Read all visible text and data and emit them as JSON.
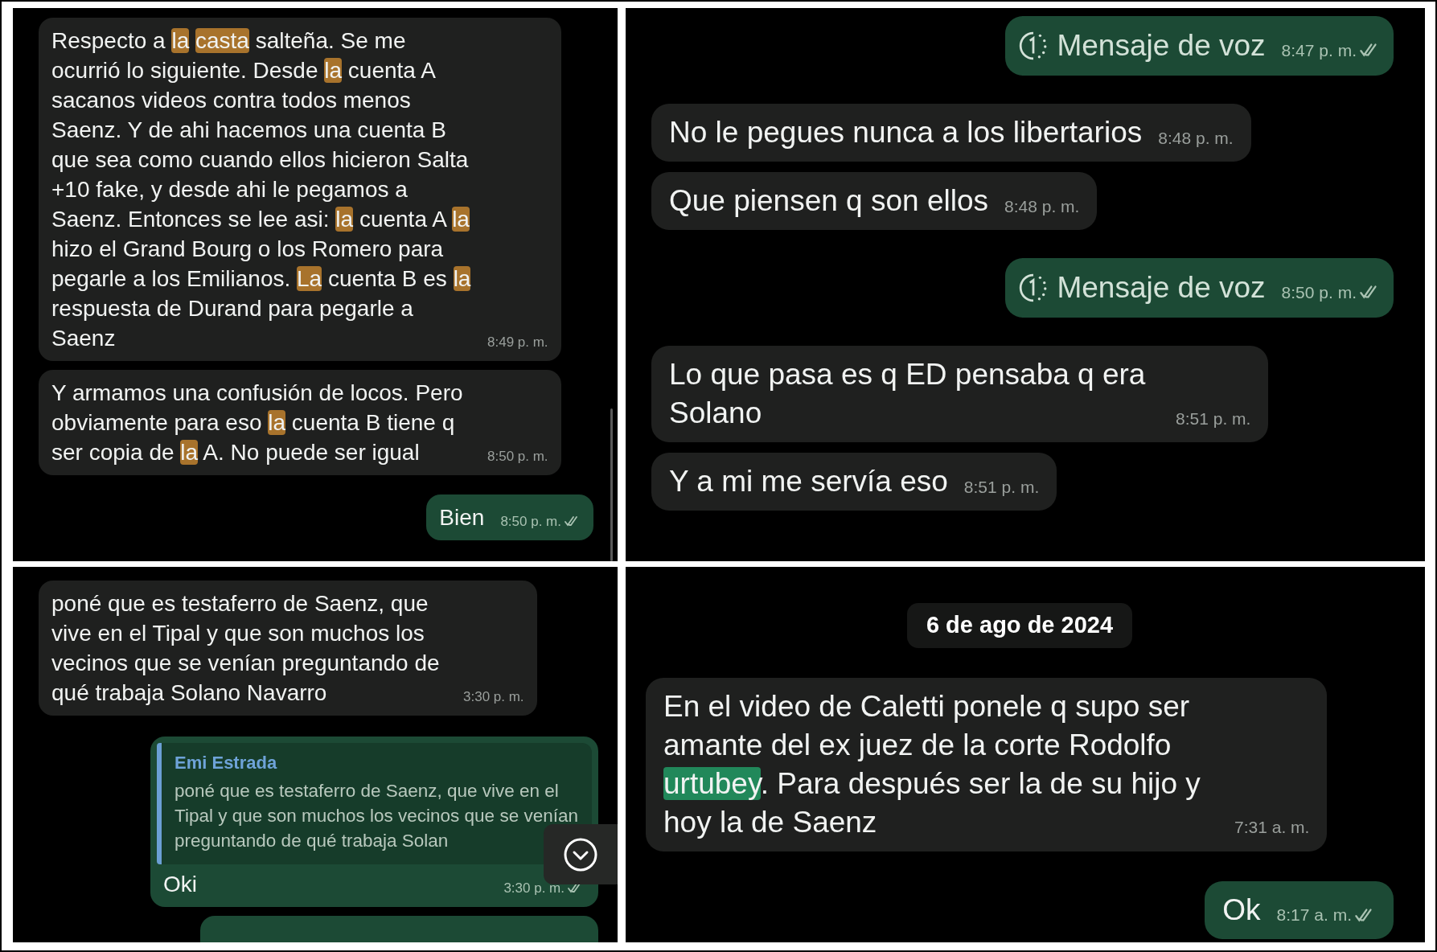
{
  "panels": [
    {
      "scrollbar": true,
      "messages": [
        {
          "kind": "text",
          "outgoing": false,
          "time": "8:49 p. m.",
          "segments": [
            {
              "text": "Respecto a "
            },
            {
              "text": "la ",
              "color": "#a8732c"
            },
            {
              "text": "casta",
              "color": "#a8732c"
            },
            {
              "text": " salteña. Se me ocurrió lo siguiente. Desde "
            },
            {
              "text": "la",
              "color": "#a8732c"
            },
            {
              "text": " cuenta A sacanos videos contra todos menos Saenz. Y de ahi hacemos una cuenta B que sea como cuando ellos hicieron Salta +10 fake, y desde ahi le pegamos a Saenz. Entonces se lee asi: "
            },
            {
              "text": "la",
              "color": "#a8732c"
            },
            {
              "text": " cuenta A "
            },
            {
              "text": "la",
              "color": "#a8732c"
            },
            {
              "text": " hizo el Grand Bourg o los Romero para pegarle a los Emilianos. "
            },
            {
              "text": "La",
              "color": "#a8732c"
            },
            {
              "text": " cuenta B es "
            },
            {
              "text": "la",
              "color": "#a8732c"
            },
            {
              "text": " respuesta de Durand para pegarle a Saenz"
            }
          ]
        },
        {
          "kind": "text",
          "outgoing": false,
          "time": "8:50 p. m.",
          "segments": [
            {
              "text": "Y armamos una confusión de locos. Pero obviamente para eso "
            },
            {
              "text": "la",
              "color": "#a8732c"
            },
            {
              "text": " cuenta B tiene q ser copia de "
            },
            {
              "text": "la",
              "color": "#a8732c"
            },
            {
              "text": " A. No puede ser igual"
            }
          ]
        },
        {
          "kind": "text",
          "outgoing": true,
          "time": "8:50 p. m.",
          "delivered": true,
          "segments": [
            {
              "text": "Bien"
            }
          ]
        }
      ]
    },
    {
      "messages": [
        {
          "kind": "voice",
          "outgoing": true,
          "label": "Mensaje de voz",
          "time": "8:47 p. m.",
          "delivered": true
        },
        {
          "kind": "text",
          "outgoing": false,
          "time": "8:48 p. m.",
          "segments": [
            {
              "text": "No le pegues nunca a los libertarios"
            }
          ]
        },
        {
          "kind": "text",
          "outgoing": false,
          "time": "8:48 p. m.",
          "segments": [
            {
              "text": "Que piensen q son ellos"
            }
          ]
        },
        {
          "kind": "voice",
          "outgoing": true,
          "label": "Mensaje de voz",
          "time": "8:50 p. m.",
          "delivered": true
        },
        {
          "kind": "text",
          "outgoing": false,
          "time": "8:51 p. m.",
          "segments": [
            {
              "text": "Lo que pasa es q ED pensaba q era Solano"
            }
          ]
        },
        {
          "kind": "text",
          "outgoing": false,
          "time": "8:51 p. m.",
          "segments": [
            {
              "text": "Y a mi me servía eso"
            }
          ]
        }
      ]
    },
    {
      "scroll_button": true,
      "messages": [
        {
          "kind": "text",
          "outgoing": false,
          "time": "3:30 p. m.",
          "segments": [
            {
              "text": "poné que es testaferro de Saenz, que vive en el Tipal y que son muchos los vecinos que se venían preguntando de qué trabaja Solano Navarro"
            }
          ]
        },
        {
          "kind": "reply",
          "outgoing": true,
          "time": "3:30 p. m.",
          "delivered": true,
          "quote": {
            "author": "Emi Estrada",
            "text": "poné que es testaferro de Saenz, que vive en el Tipal y que son muchos los vecinos que se venían preguntando de qué trabaja Solan"
          },
          "segments": [
            {
              "text": "Oki"
            }
          ]
        },
        {
          "kind": "cut_off",
          "outgoing": true
        }
      ]
    },
    {
      "messages": [
        {
          "kind": "date",
          "label": "6 de ago de 2024"
        },
        {
          "kind": "text",
          "outgoing": false,
          "time": "7:31 a. m.",
          "segments": [
            {
              "text": "En el video de Caletti ponele q supo ser amante del ex juez de la corte Rodolfo "
            },
            {
              "text": "urtubey",
              "color": "#21885a"
            },
            {
              "text": ". Para después ser la de su hijo y hoy la de Saenz"
            }
          ]
        },
        {
          "kind": "text",
          "outgoing": true,
          "time": "8:17 a. m.",
          "delivered": true,
          "segments": [
            {
              "text": "Ok"
            }
          ]
        }
      ]
    }
  ]
}
